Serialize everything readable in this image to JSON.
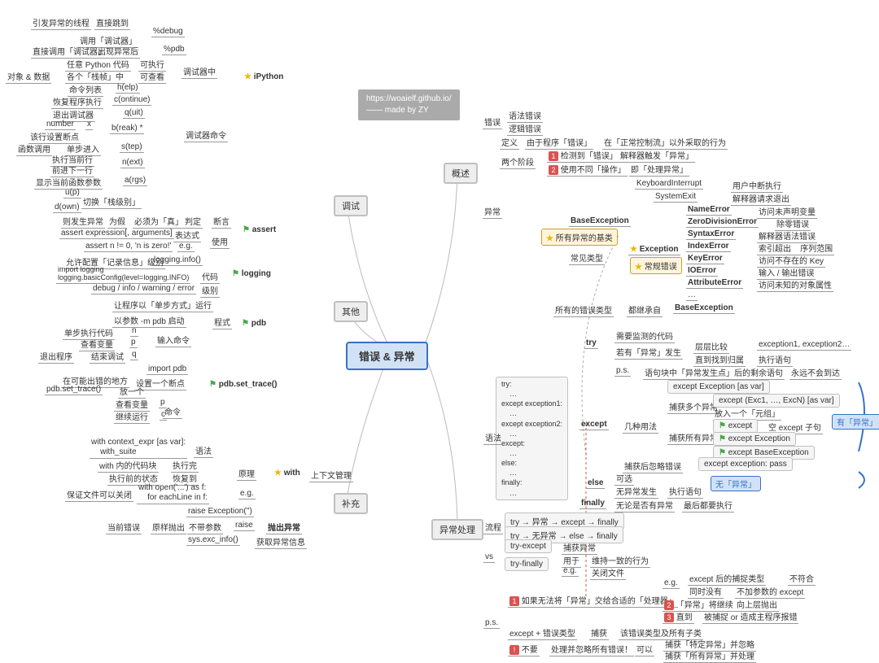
{
  "header": {
    "l1": "https://woaielf.github.io/",
    "l2": "—— made by ZY"
  },
  "center": "错误 & 异常",
  "hubs": {
    "debug": "调试",
    "other": "其他",
    "supp": "补充",
    "overview": "概述",
    "handle": "异常处理"
  },
  "sub": {
    "assert": "assert",
    "logging": "logging",
    "pdb": "pdb",
    "pdbset": "pdb.set_trace()",
    "with": "with",
    "ipython": "iPython",
    "cmds": "调试器命令",
    "dbg_in": "调试器中",
    "syntax": "语法",
    "usage": "使用",
    "mode": "程式",
    "input": "输入命令",
    "cmd": "命令",
    "cls": "上下文管理",
    "thr": "抛出异常",
    "princ": "原理",
    "eg": "e.g.",
    "code": "代码",
    "level": "级别",
    "expr": "表达式",
    "judge": "判定",
    "assertion": "断言"
  },
  "left": {
    "debug1": "引发异常的线程",
    "debug2": "直接跳到",
    "debug3": "%debug",
    "debug4": "调用「调试器」",
    "debug5": "直接调用「调试器」",
    "debug6": "出现异常后",
    "debug7": "%pdb",
    "debug8": "任意 Python 代码",
    "debug9": "可执行",
    "debug10": "对象 & 数据",
    "debug11": "各个「栈帧」中",
    "debug12": "可查看",
    "cmd1": "命令列表",
    "cmd2": "h(elp)",
    "cmd3": "恢复程序执行",
    "cmd4": "c(ontinue)",
    "cmd5": "退出调试器",
    "cmd6": "q(uit)",
    "cmd7": "number",
    "cmd8": "x",
    "cmd9": "b(reak) *",
    "cmd10": "该行设置断点",
    "cmd11": "函数调用",
    "cmd12": "单步进入",
    "cmd13": "s(tep)",
    "cmd14": "执行当前行",
    "cmd15": "n(ext)",
    "cmd16": "前进下一行",
    "cmd17": "显示当前函数参数",
    "cmd18": "a(rgs)",
    "cmd19": "u(p)",
    "cmd20": "切换「栈级别」",
    "cmd21": "d(own)",
    "as1": "则发生异常",
    "as2": "为假",
    "as3": "必须为「真」",
    "as4": "assert expression[, arguments]",
    "as5": "assert n != 0, 'n is zero!'",
    "log1": "允许配置「记录信息」级别",
    "log2": "logging.info()",
    "log3": "import logging\nlogging.basicConfig(level=logging.INFO)",
    "log4": "debug / info / warning / error",
    "pdb1": "让程序以「单步方式」运行",
    "pdb2": "以参数 -m pdb 启动",
    "pdb3": "单步执行代码",
    "pdb4": "n",
    "pdb5": "查看变量",
    "pdb6": "p",
    "pdb7": "退出程序",
    "pdb8": "结束调试",
    "pdb9": "q",
    "pdb10": "import pdb",
    "pdb11": "在可能出错的地方",
    "pdb12": "设置一个断点",
    "pdb13": "pdb.set_trace()",
    "pdb14": "放一个",
    "pdb15": "查看变量",
    "pdb16": "p",
    "pdb17": "继续运行",
    "pdb18": "c",
    "w1": "with context_expr [as var]:\n    with_suite",
    "w2": "with 内的代码块",
    "w3": "执行完",
    "w4": "执行前的状态",
    "w5": "恢复到",
    "w6": "with open('...') as f:\n    for eachLine in f:",
    "w7": "保证文件可以关闭",
    "th1": "当前错误",
    "th2": "原样抛出",
    "th3": "raise Exception('')",
    "th4": "不带参数",
    "th5": "raise",
    "th6": "sys.exc_info()",
    "th7": "获取异常信息"
  },
  "right": {
    "err1": "错误",
    "err2": "语法错误",
    "err3": "逻辑错误",
    "def1": "定义",
    "def2": "由于程序「错误」",
    "def3": "在「正常控制流」以外采取的行为",
    "ph1": "两个阶段",
    "ph2": "检测到「错误」",
    "ph3": "解释器触发「异常」",
    "ph4": "使用不同「操作」",
    "ph5": "即「处理异常」",
    "exc": "异常",
    "cls1": "KeyboardInterrupt",
    "cls1d": "用户中断执行",
    "cls2": "SystemExit",
    "cls2d": "解释器请求退出",
    "cls3": "NameError",
    "cls3d": "访问未声明变量",
    "cls4": "ZeroDivisionError",
    "cls4d": "除零错误",
    "cls5": "SyntaxError",
    "cls5d": "解释器语法错误",
    "cls6": "IndexError",
    "cls6d": "索引超出    序列范围",
    "cls7": "KeyError",
    "cls7d": "访问不存在的 Key",
    "cls8": "IOError",
    "cls8d": "输入 / 输出错误",
    "cls9": "AttributeError",
    "cls9d": "访问未知的对象属性",
    "cls10": "…",
    "base1": "BaseException",
    "base2": "所有异常的基类",
    "base3": "Exception",
    "base4": "常规错误",
    "base5": "常见类型",
    "base6": "所有的错误类型",
    "base7": "都继承自",
    "base8": "BaseException",
    "try1": "try",
    "try2": "需要监测的代码",
    "try3": "若有「异常」发生",
    "try4": "层层比较",
    "try5": "exception1, exception2…",
    "try6": "直到找到归属",
    "try7": "执行语句",
    "try8": "p.s.",
    "try9": "语句块中「异常发生点」后的剩余语句",
    "try10": "永远不会到达",
    "code": "try:\n    …\nexcept exception1:\n    …\nexcept exception2:\n    …\nexcept:\n    …\nelse:\n    …\nfinally:\n    …",
    "gram": "语法",
    "exp": "except",
    "exp1": "except Exception [as var]",
    "exp2": "except (Exc1, …, ExcN) [as var]",
    "exp3": "放入一个「元组」",
    "exp4": "except",
    "exp5": "空 except 子句",
    "exp6": "except Exception",
    "exp7": "except BaseException",
    "exp8": "except exception: pass",
    "u1": "几种用法",
    "u2": "捕获多个异常",
    "u3": "捕获所有异常",
    "u4": "捕获后忽略错误",
    "hasExc": "有「异常」",
    "noExc": "无「异常」",
    "else": "else",
    "else1": "可选",
    "else2": "无异常发生",
    "else3": "执行语句",
    "fin": "finally",
    "fin1": "无论是否有异常",
    "fin2": "最后都要执行",
    "flow": "流程",
    "flow1": "try → 异常 → except → finally",
    "flow2": "try → 无异常 → else → finally",
    "vs": "vs",
    "vs1": "try-except",
    "vs2": "捕获异常",
    "vs3": "try-finally",
    "vs4": "用于",
    "vs5": "维持一致的行为",
    "vs6": "e.g.",
    "vs7": "关闭文件",
    "ps": "p.s.",
    "ps1": "如果无法将「异常」交给合适的「处理器」",
    "ps2": "e.g.",
    "ps3": "except 后的捕捉类型",
    "ps4": "不符合",
    "ps5": "同时没有",
    "ps6": "不加参数的 except",
    "ps7": "「异常」将继续",
    "ps8": "向上层抛出",
    "ps9": "直到",
    "ps10": "被捕捉 or 造成主程序报错",
    "ps11": "except + 错误类型",
    "ps12": "捕获",
    "ps13": "该错误类型及所有子类",
    "ps14": "不要",
    "ps15": "处理并忽略所有错误！",
    "ps16": "可以",
    "ps17": "捕获「特定异常」并忽略",
    "ps18": "捕获「所有异常」并处理"
  }
}
